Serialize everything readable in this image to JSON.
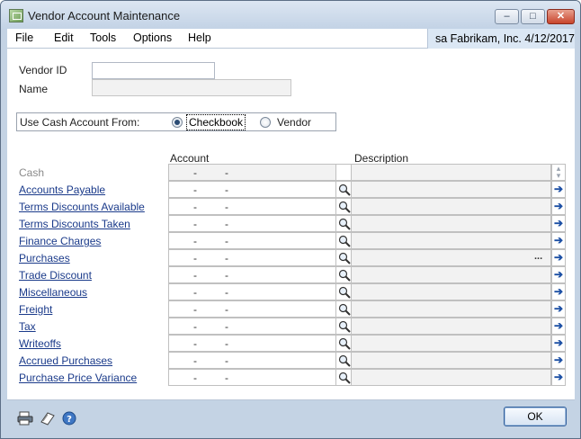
{
  "window": {
    "title": "Vendor Account Maintenance"
  },
  "menu": {
    "items": [
      "File",
      "Edit",
      "Tools",
      "Options",
      "Help"
    ]
  },
  "company_info": "sa  Fabrikam, Inc.  4/12/2017",
  "fields": {
    "vendor_id_label": "Vendor ID",
    "vendor_id_value": "",
    "name_label": "Name",
    "name_value": ""
  },
  "cash_account_from": {
    "label": "Use Cash Account From:",
    "options": [
      {
        "label": "Checkbook",
        "selected": true
      },
      {
        "label": "Vendor",
        "selected": false
      }
    ]
  },
  "grid": {
    "account_header": "Account",
    "description_header": "Description",
    "rows": [
      {
        "label": "Cash",
        "account": "-        -",
        "description": "",
        "enabled": false
      },
      {
        "label": "Accounts Payable",
        "account": "-        -",
        "description": "",
        "enabled": true
      },
      {
        "label": "Terms Discounts Available",
        "account": "-        -",
        "description": "",
        "enabled": true
      },
      {
        "label": "Terms Discounts Taken",
        "account": "-        -",
        "description": "",
        "enabled": true
      },
      {
        "label": "Finance Charges",
        "account": "-        -",
        "description": "",
        "enabled": true
      },
      {
        "label": "Purchases",
        "account": "-        -",
        "description": "",
        "enabled": true
      },
      {
        "label": "Trade Discount",
        "account": "-        -",
        "description": "",
        "enabled": true
      },
      {
        "label": "Miscellaneous",
        "account": "-        -",
        "description": "",
        "enabled": true
      },
      {
        "label": "Freight",
        "account": "-        -",
        "description": "",
        "enabled": true
      },
      {
        "label": "Tax",
        "account": "-        -",
        "description": "",
        "enabled": true
      },
      {
        "label": "Writeoffs",
        "account": "-        -",
        "description": "",
        "enabled": true
      },
      {
        "label": "Accrued Purchases",
        "account": "-        -",
        "description": "",
        "enabled": true
      },
      {
        "label": "Purchase Price Variance",
        "account": "-        -",
        "description": "",
        "enabled": true
      }
    ],
    "ellipsis": "..."
  },
  "buttons": {
    "ok": "OK"
  },
  "icons": {
    "app": "app-window-icon",
    "lookup": "magnifier-lookup-icon",
    "expand": "blue-right-arrow-icon",
    "print": "printer-icon",
    "note": "note-icon",
    "help": "help-icon"
  },
  "colors": {
    "link": "#1a3a8a",
    "arrow": "#1c4fa4",
    "chrome": "#c4d3e4"
  }
}
